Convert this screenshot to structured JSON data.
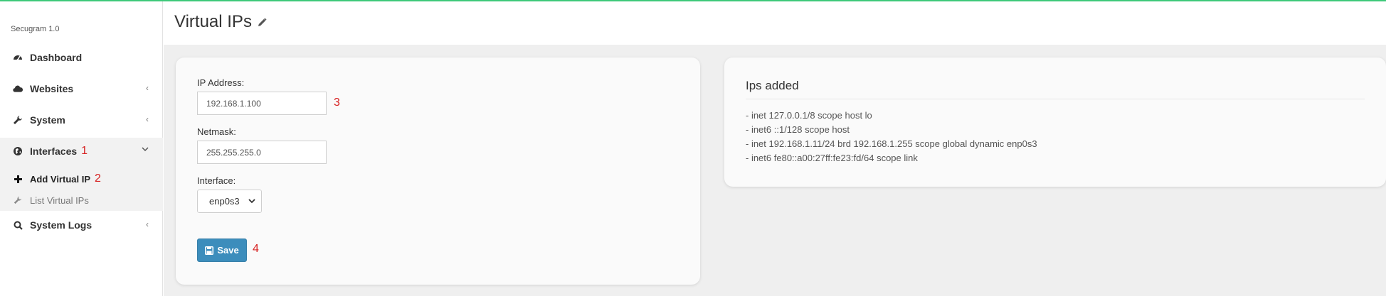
{
  "app": {
    "brand": "Secugram 1.0"
  },
  "sidebar": {
    "items": [
      {
        "label": "Dashboard",
        "icon": "dashboard-icon"
      },
      {
        "label": "Websites",
        "icon": "cloud-icon",
        "chevron": "‹"
      },
      {
        "label": "System",
        "icon": "wrench-icon",
        "chevron": "‹"
      },
      {
        "label": "Interfaces",
        "icon": "globe-icon",
        "chevron": "⌄",
        "annotation": "1"
      },
      {
        "label": "System Logs",
        "icon": "search-icon",
        "chevron": "‹"
      }
    ],
    "subitems": [
      {
        "label": "Add Virtual IP",
        "icon": "plus-icon",
        "annotation": "2"
      },
      {
        "label": "List Virtual IPs",
        "icon": "wrench-icon"
      }
    ]
  },
  "header": {
    "title": "Virtual IPs",
    "edit_icon": "pencil-icon"
  },
  "form": {
    "ip_label": "IP Address:",
    "ip_value": "192.168.1.100",
    "ip_annotation": "3",
    "netmask_label": "Netmask:",
    "netmask_value": "255.255.255.0",
    "interface_label": "Interface:",
    "interface_value": "enp0s3",
    "save_label": "Save",
    "save_annotation": "4"
  },
  "ips_panel": {
    "title": "Ips added",
    "entries": [
      "- inet 127.0.0.1/8 scope host lo",
      "- inet6 ::1/128 scope host",
      "- inet 192.168.1.11/24 brd 192.168.1.255 scope global dynamic enp0s3",
      "- inet6 fe80::a00:27ff:fe23:fd/64 scope link"
    ]
  },
  "colors": {
    "accent": "#3c8dbc",
    "top_line": "#3ec97a",
    "annotation": "#d62020"
  }
}
